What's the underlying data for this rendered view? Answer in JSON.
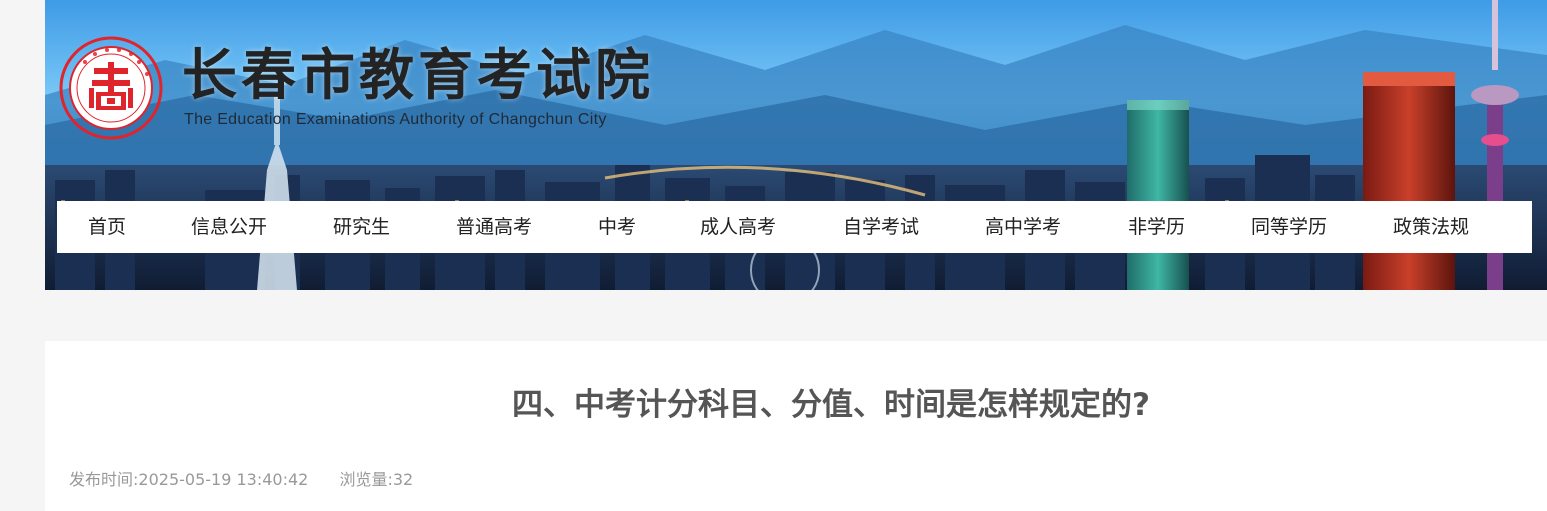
{
  "header": {
    "title": "长春市教育考试院",
    "subtitle": "The Education Examinations Authority of Changchun City"
  },
  "nav": {
    "items": [
      {
        "label": "首页"
      },
      {
        "label": "信息公开"
      },
      {
        "label": "研究生"
      },
      {
        "label": "普通高考"
      },
      {
        "label": "中考"
      },
      {
        "label": "成人高考"
      },
      {
        "label": "自学考试"
      },
      {
        "label": "高中学考"
      },
      {
        "label": "非学历"
      },
      {
        "label": "同等学历"
      },
      {
        "label": "政策法规"
      }
    ]
  },
  "article": {
    "title": "四、中考计分科目、分值、时间是怎样规定的?",
    "publish_label": "发布时间:",
    "publish_time": "2025-05-19 13:40:42",
    "views_label": "浏览量:",
    "views": "32"
  },
  "colors": {
    "page_background": "#f5f5f5",
    "logo_red": "#e0242c",
    "title_text": "#555555",
    "meta_text": "#999999"
  }
}
